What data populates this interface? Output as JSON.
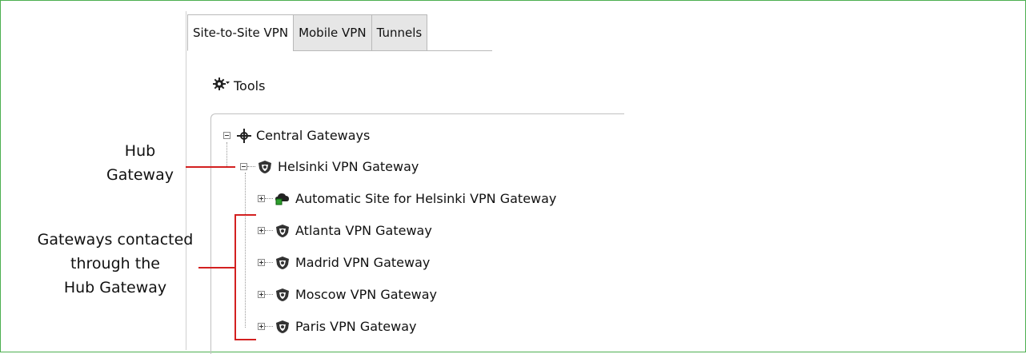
{
  "tabs": [
    {
      "label": "Site-to-Site VPN",
      "active": true
    },
    {
      "label": "Mobile VPN",
      "active": false
    },
    {
      "label": "Tunnels",
      "active": false
    }
  ],
  "toolbar": {
    "tools_label": "Tools",
    "tools_icon": "gear-icon"
  },
  "tree": {
    "root": {
      "label": "Central Gateways",
      "icon": "central-gateways-icon"
    },
    "hub": {
      "label": "Helsinki VPN Gateway",
      "icon": "vpn-gateway-icon"
    },
    "children": [
      {
        "label": "Automatic Site for Helsinki VPN Gateway",
        "icon": "site-icon"
      },
      {
        "label": "Atlanta VPN Gateway",
        "icon": "vpn-gateway-icon"
      },
      {
        "label": "Madrid VPN Gateway",
        "icon": "vpn-gateway-icon"
      },
      {
        "label": "Moscow VPN Gateway",
        "icon": "vpn-gateway-icon"
      },
      {
        "label": "Paris VPN Gateway",
        "icon": "vpn-gateway-icon"
      }
    ]
  },
  "annotations": {
    "hub_line1": "Hub",
    "hub_line2": "Gateway",
    "contacted_line1": "Gateways contacted",
    "contacted_line2": "through the",
    "contacted_line3": "Hub Gateway"
  },
  "colors": {
    "frame_border": "#4caf50",
    "annotation_red": "#d32020"
  }
}
